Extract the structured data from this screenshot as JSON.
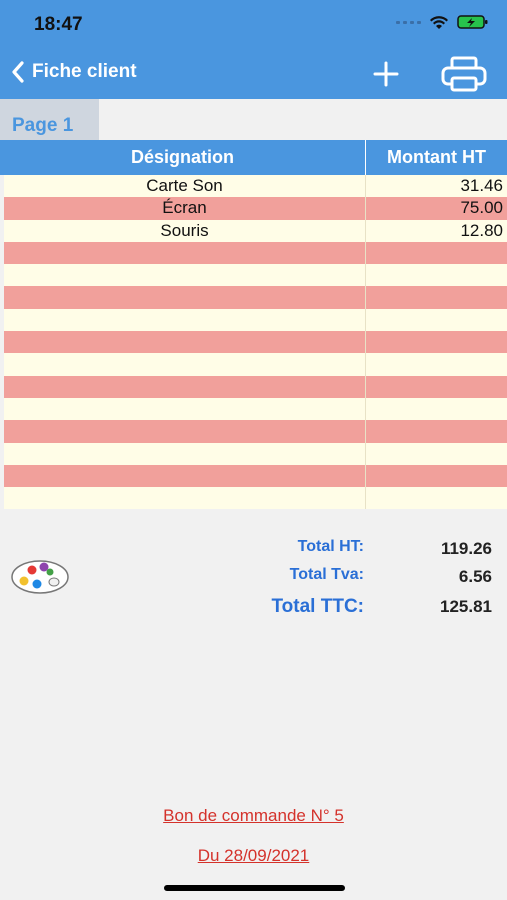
{
  "status": {
    "time": "18:47"
  },
  "nav": {
    "back_label": "Fiche client"
  },
  "page_tab": "Page 1",
  "table": {
    "headers": {
      "designation": "Désignation",
      "montant": "Montant HT"
    },
    "rows": [
      {
        "designation": "Carte Son",
        "montant": "31.46"
      },
      {
        "designation": "Écran",
        "montant": "75.00"
      },
      {
        "designation": "Souris",
        "montant": "12.80"
      },
      {
        "designation": "",
        "montant": ""
      },
      {
        "designation": "",
        "montant": ""
      },
      {
        "designation": "",
        "montant": ""
      },
      {
        "designation": "",
        "montant": ""
      },
      {
        "designation": "",
        "montant": ""
      },
      {
        "designation": "",
        "montant": ""
      },
      {
        "designation": "",
        "montant": ""
      },
      {
        "designation": "",
        "montant": ""
      },
      {
        "designation": "",
        "montant": ""
      },
      {
        "designation": "",
        "montant": ""
      },
      {
        "designation": "",
        "montant": ""
      },
      {
        "designation": "",
        "montant": ""
      }
    ]
  },
  "totals": {
    "ht_label": "Total HT:",
    "ht_value": "119.26",
    "tva_label": "Total Tva:",
    "tva_value": "6.56",
    "ttc_label": "Total TTC:",
    "ttc_value": "125.81"
  },
  "footer": {
    "order_label": "Bon de commande N° 5",
    "date_label": "Du 28/09/2021"
  },
  "colors": {
    "header_blue": "#4a96df",
    "row_light": "#fffde7",
    "row_pink": "#f1a09b",
    "total_label": "#2a6fd6",
    "footer_red": "#d4322b"
  },
  "icons": [
    "back-chevron-icon",
    "plus-icon",
    "printer-icon",
    "palette-icon",
    "wifi-icon",
    "battery-icon",
    "signal-icon"
  ]
}
